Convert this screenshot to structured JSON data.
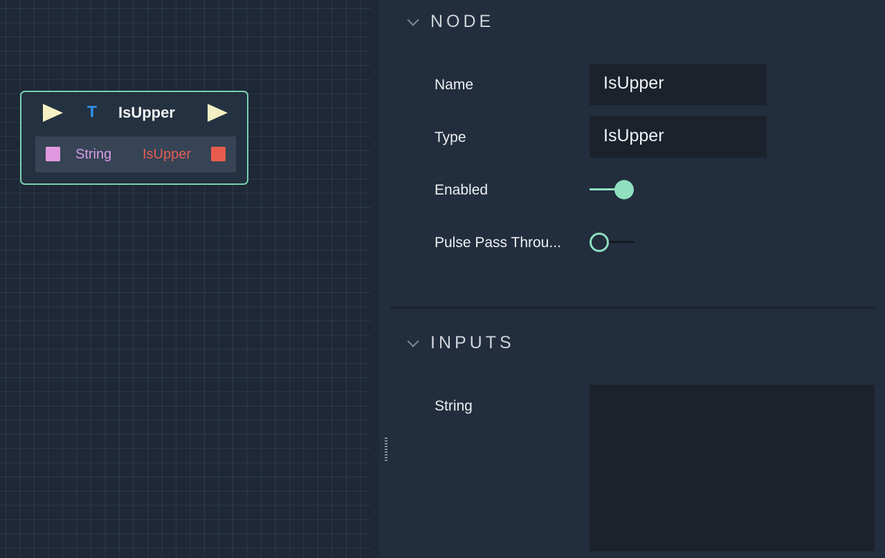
{
  "node": {
    "title": "IsUpper",
    "type_glyph": "T",
    "icons": {
      "flow_in": "play-triangle-icon",
      "flow_out": "play-triangle-icon",
      "type": "text-type-icon"
    },
    "inputs": [
      {
        "label": "String",
        "color": "#e199e1"
      }
    ],
    "outputs": [
      {
        "label": "IsUpper",
        "color": "#e85c4d"
      }
    ],
    "border_color": "#7ad1b0"
  },
  "inspector": {
    "node_section": {
      "title": "NODE",
      "fields": {
        "name": {
          "label": "Name",
          "value": "IsUpper"
        },
        "type": {
          "label": "Type",
          "value": "IsUpper"
        },
        "enabled": {
          "label": "Enabled",
          "checked": true
        },
        "pulse_pass_through": {
          "label": "Pulse Pass Throu...",
          "checked": false
        }
      }
    },
    "inputs_section": {
      "title": "INPUTS",
      "fields": {
        "string": {
          "label": "String",
          "value": ""
        }
      }
    },
    "accent_color": "#8ee0c0"
  }
}
